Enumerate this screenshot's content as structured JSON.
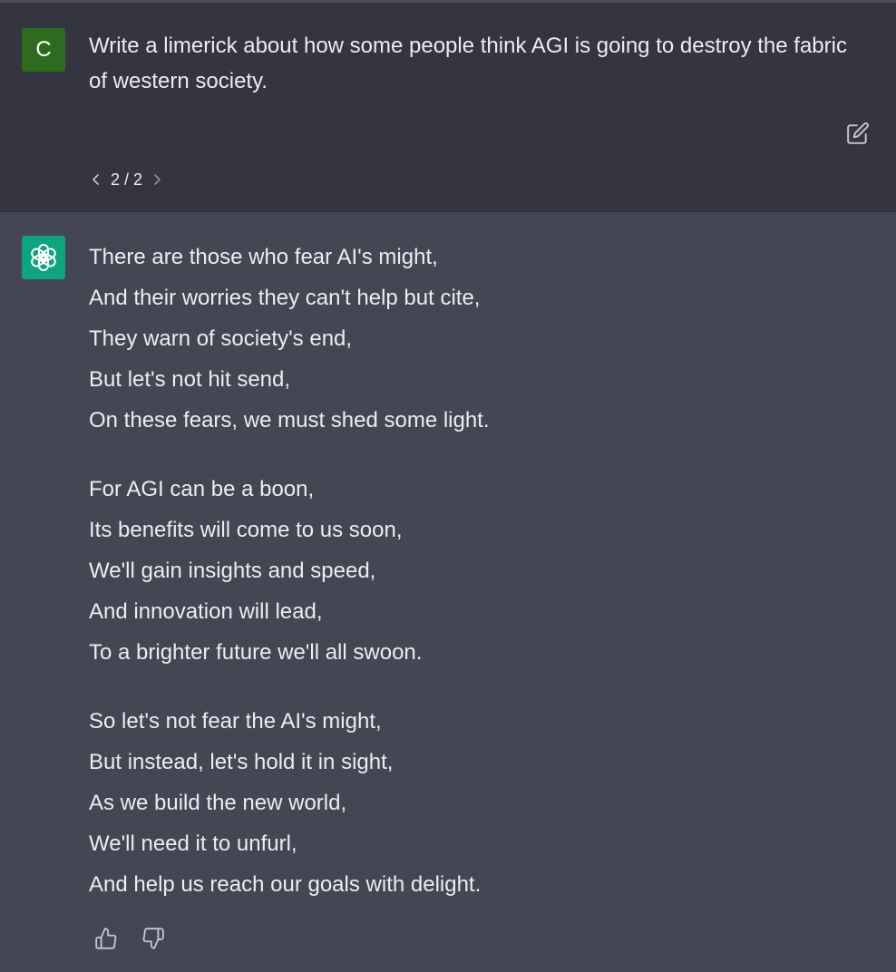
{
  "user_message": {
    "avatar_letter": "C",
    "text": "Write a limerick about how some people think AGI is going to destroy the fabric of western society.",
    "pager": "2 / 2"
  },
  "assistant_message": {
    "stanzas": [
      [
        "There are those who fear AI's might,",
        "And their worries they can't help but cite,",
        "They warn of society's end,",
        "But let's not hit send,",
        "On these fears, we must shed some light."
      ],
      [
        "For AGI can be a boon,",
        "Its benefits will come to us soon,",
        "We'll gain insights and speed,",
        "And innovation will lead,",
        "To a brighter future we'll all swoon."
      ],
      [
        "So let's not fear the AI's might,",
        "But instead, let's hold it in sight,",
        "As we build the new world,",
        "We'll need it to unfurl,",
        "And help us reach our goals with delight."
      ]
    ]
  },
  "icons": {
    "edit": "edit-icon",
    "prev": "chevron-left-icon",
    "next": "chevron-right-icon",
    "assistant_logo": "openai-logo-icon",
    "thumbs_up": "thumbs-up-icon",
    "thumbs_down": "thumbs-down-icon"
  },
  "colors": {
    "user_bg": "#343541",
    "assistant_bg": "#444654",
    "user_avatar": "#2f6b1f",
    "assistant_avatar": "#10a37f",
    "text": "#ececf1"
  }
}
